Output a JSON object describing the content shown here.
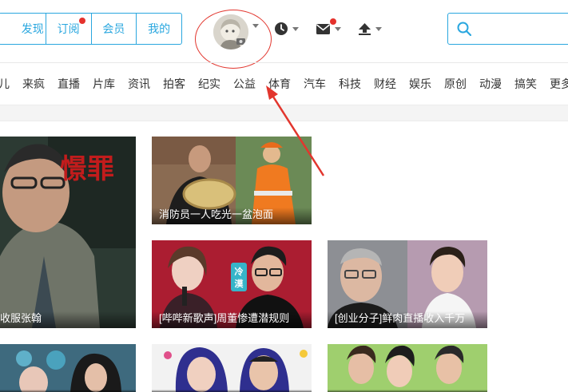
{
  "nav": {
    "tabs": [
      {
        "label": "发现"
      },
      {
        "label": "订阅",
        "has_dot": true
      },
      {
        "label": "会员"
      },
      {
        "label": "我的"
      }
    ]
  },
  "header_icons": [
    {
      "name": "history-clock-icon"
    },
    {
      "name": "message-envelope-icon",
      "has_dot": true
    },
    {
      "name": "upload-icon"
    }
  ],
  "search": {
    "placeholder": ""
  },
  "categories": [
    "儿",
    "来疯",
    "直播",
    "片库",
    "资讯",
    "拍客",
    "纪实",
    "公益",
    "体育",
    "汽车",
    "科技",
    "财经",
    "娱乐",
    "原创",
    "动漫",
    "搞笑",
    "更多"
  ],
  "tiles": [
    {
      "caption": "收服张翰",
      "poster_text": "憬罪"
    },
    {
      "caption": "消防员一人吃光一盆泡面"
    },
    {
      "caption": "[哔哔新歌声]周董惨遭潜规则",
      "badge": "冷漠"
    },
    {
      "caption": "[创业分子]鲜肉直播收入千万"
    },
    {
      "caption": ""
    },
    {
      "caption": ""
    },
    {
      "caption": ""
    }
  ],
  "colors": {
    "accent": "#2aa7df",
    "notify": "#e5322d",
    "annotation": "#e2362e"
  }
}
